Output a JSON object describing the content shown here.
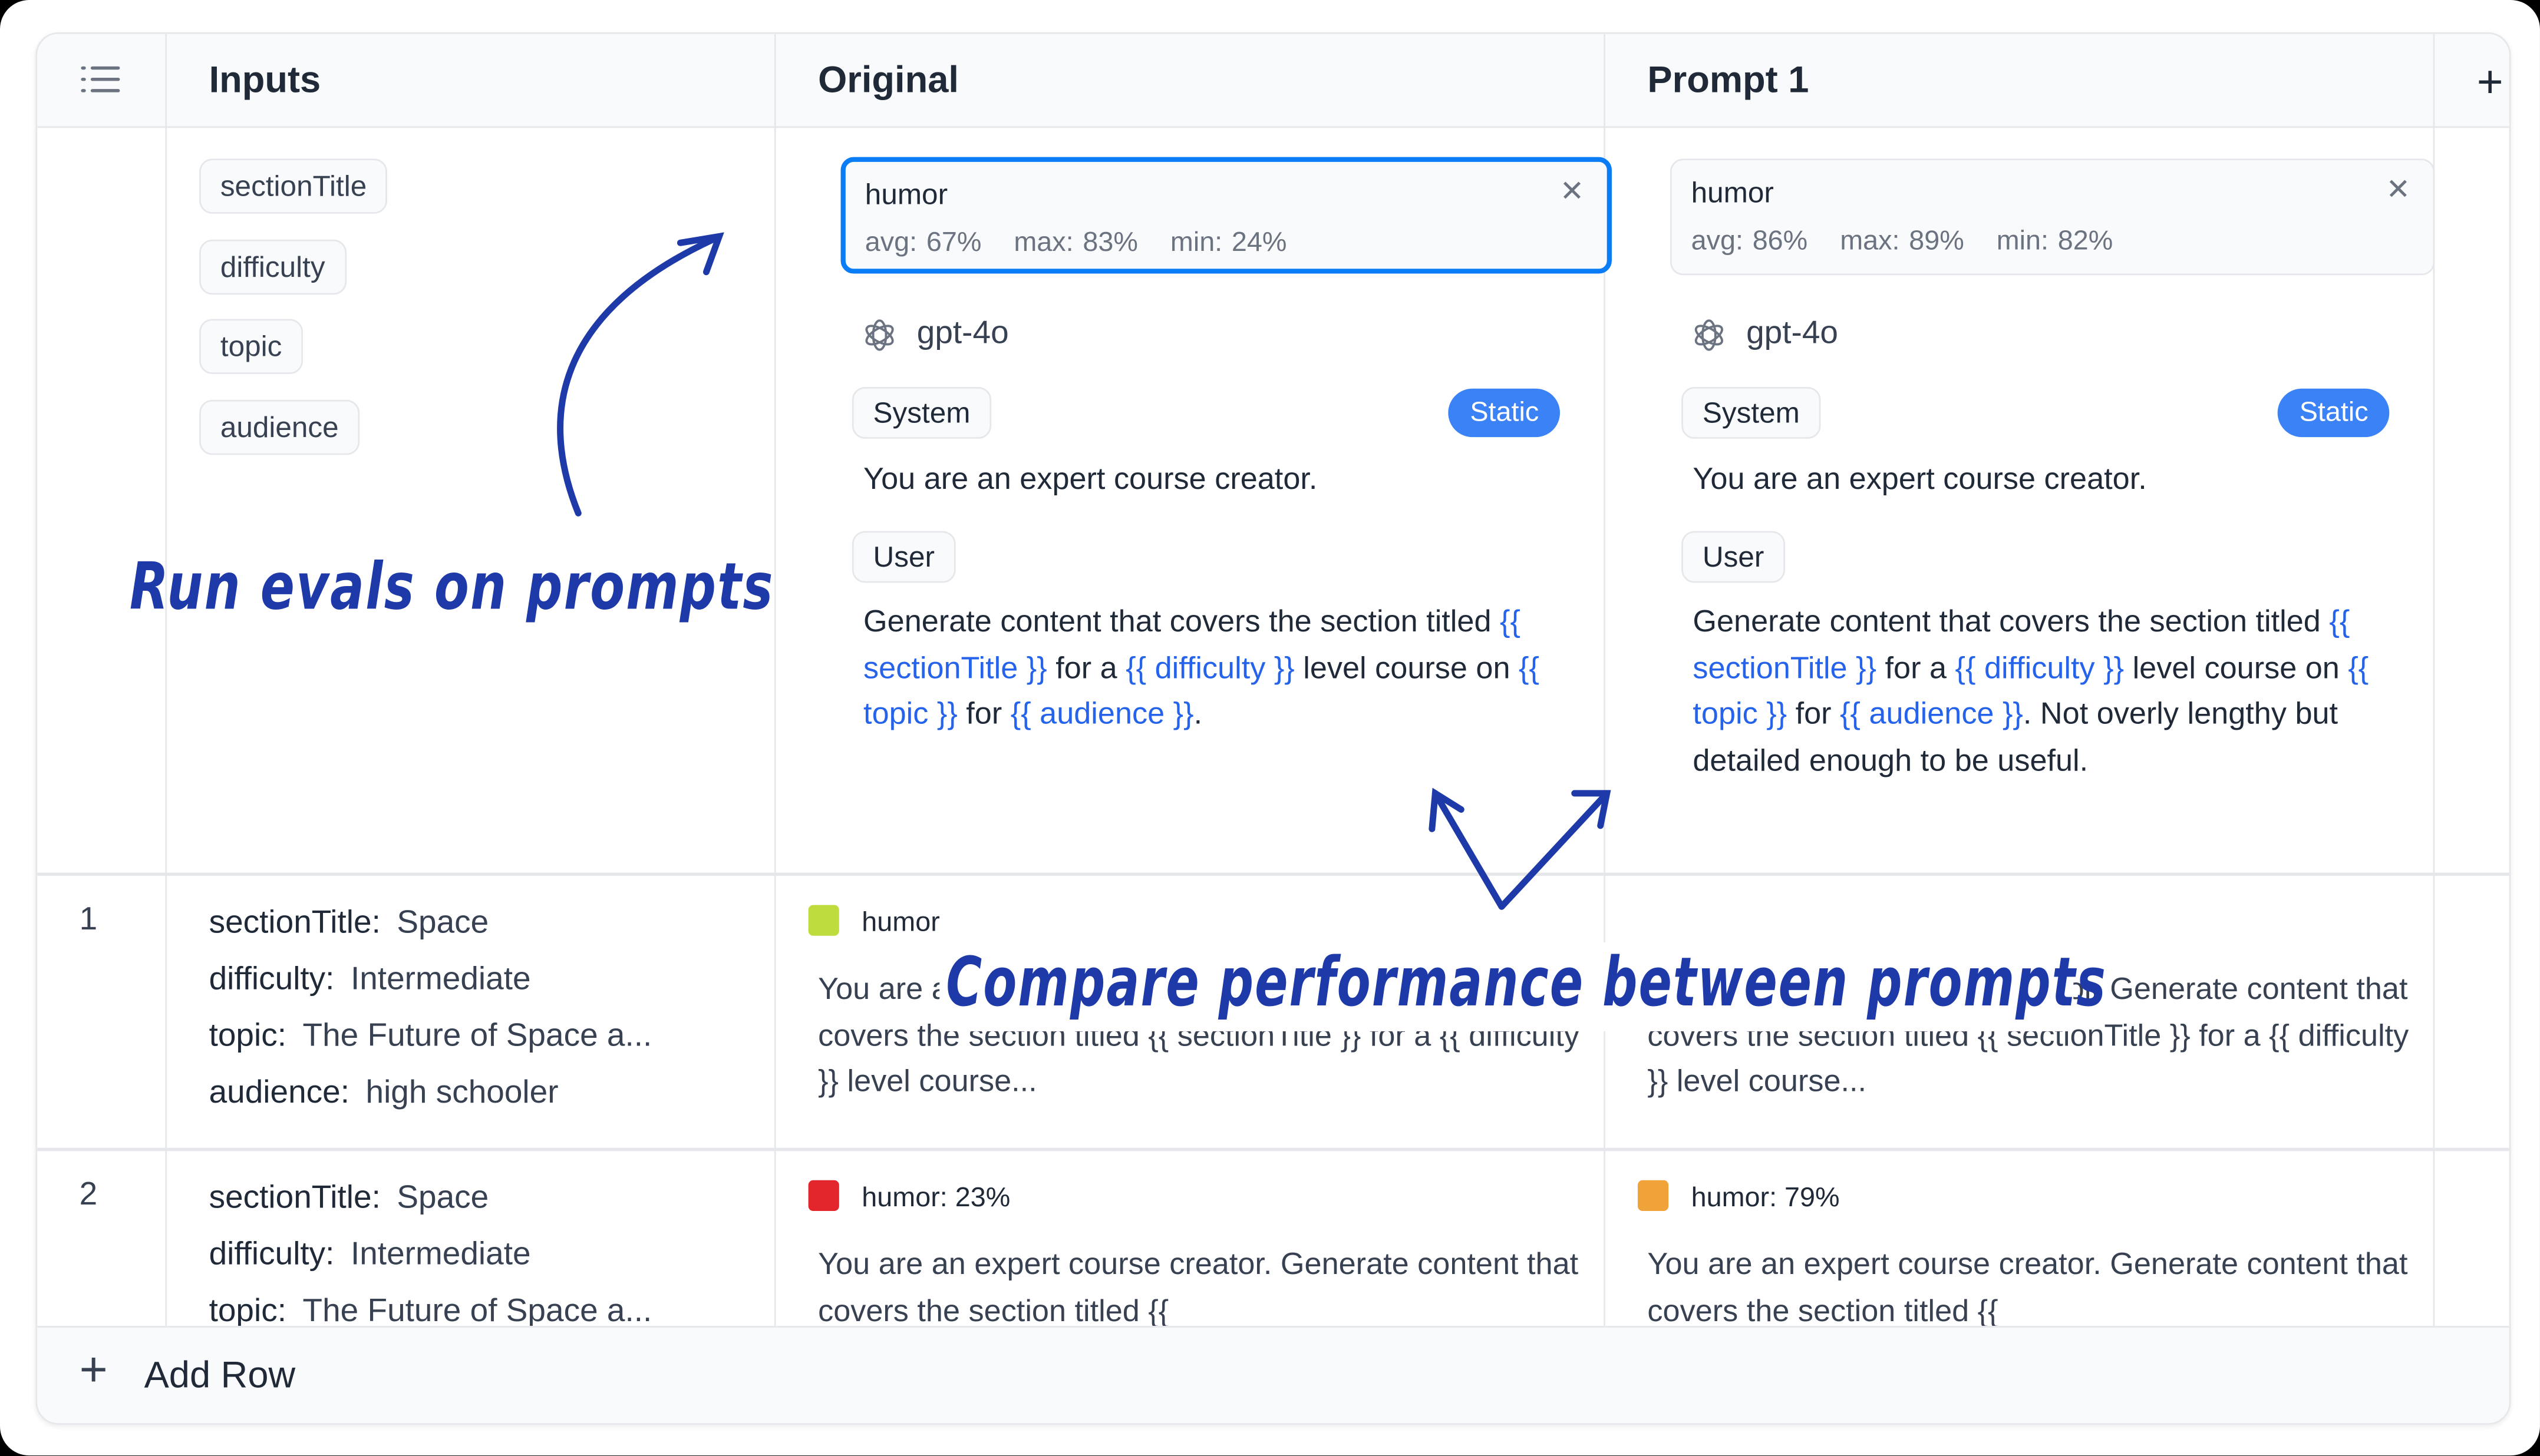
{
  "header": {
    "inputs": "Inputs",
    "columns": [
      "Original",
      "Prompt 1"
    ],
    "add_column_icon": "plus-icon",
    "menu_icon": "list-icon"
  },
  "inputs": [
    "sectionTitle",
    "difficulty",
    "topic",
    "audience"
  ],
  "prompts": [
    {
      "eval": {
        "name": "humor",
        "avg": "avg: 67%",
        "max": "max: 83%",
        "min": "min: 24%"
      },
      "model": "gpt-4o",
      "system_label": "System",
      "static_label": "Static",
      "system_text": "You are an expert course creator.",
      "user_label": "User",
      "user_text": [
        "Generate content that covers the section titled ",
        "{{ sectionTitle }}",
        " for a ",
        "{{ difficulty }}",
        " level course on ",
        "{{ topic }}",
        " for ",
        "{{ audience }}",
        "."
      ]
    },
    {
      "eval": {
        "name": "humor",
        "avg": "avg: 86%",
        "max": "max: 89%",
        "min": "min: 82%"
      },
      "model": "gpt-4o",
      "system_label": "System",
      "static_label": "Static",
      "system_text": "You are an expert course creator.",
      "user_label": "User",
      "user_text": [
        "Generate content that covers the section titled ",
        "{{ sectionTitle }}",
        " for a ",
        "{{ difficulty }}",
        " level course on ",
        "{{ topic }}",
        " for ",
        "{{ audience }}",
        ". Not overly lengthy but detailed enough to be useful."
      ]
    }
  ],
  "rows": [
    {
      "num": "1",
      "inputs": [
        {
          "k": "sectionTitle:",
          "v": "Space"
        },
        {
          "k": "difficulty:",
          "v": "Intermediate"
        },
        {
          "k": "topic:",
          "v": "The Future of Space a..."
        },
        {
          "k": "audience:",
          "v": "high schooler"
        }
      ],
      "outputs": [
        {
          "score": "humor",
          "color": "#bfdc3f",
          "text": "You are an expert course creator. Generate content that covers the section titled {{ sectionTitle }} for a {{ difficulty }} level course..."
        },
        {
          "score": "",
          "color": "",
          "text": "You are an expert course creator. Generate content that covers the section titled {{ sectionTitle }} for a {{ difficulty }} level course..."
        }
      ]
    },
    {
      "num": "2",
      "inputs": [
        {
          "k": "sectionTitle:",
          "v": "Space"
        },
        {
          "k": "difficulty:",
          "v": "Intermediate"
        },
        {
          "k": "topic:",
          "v": "The Future of Space a..."
        }
      ],
      "outputs": [
        {
          "score": "humor: 23%",
          "color": "#e3262b",
          "text": "You are an expert course creator. Generate content that covers the section titled {{"
        },
        {
          "score": "humor: 79%",
          "color": "#f0a338",
          "text": "You are an expert course creator. Generate content that covers the section titled {{"
        }
      ]
    }
  ],
  "footer": {
    "add_row": "Add Row"
  },
  "annotations": {
    "run_evals": "Run evals on prompts",
    "compare": "Compare performance between prompts"
  },
  "colors": {
    "accent": "#3b82f6",
    "annotation": "#1e3aa8"
  }
}
